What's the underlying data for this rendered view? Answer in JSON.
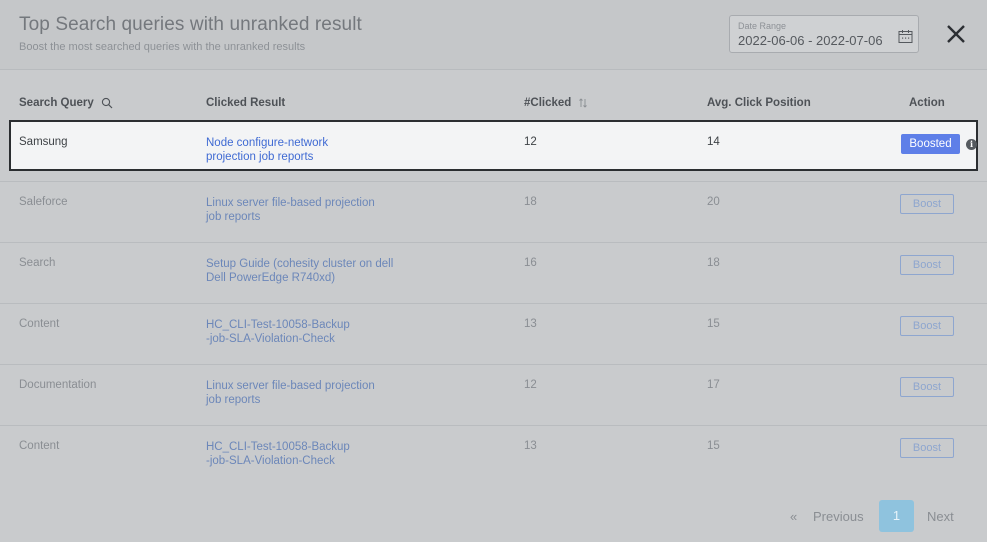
{
  "header": {
    "title": "Top Search queries with unranked result",
    "subtitle": "Boost the most searched queries with the unranked results",
    "date_range_label": "Date Range",
    "date_range_value": "2022-06-06 - 2022-07-06",
    "calendar_icon": "calendar-icon",
    "close_icon": "close-icon"
  },
  "table": {
    "columns": [
      "Search Query",
      "Clicked Result",
      "#Clicked",
      "Avg. Click Position",
      "Action"
    ],
    "rows": [
      {
        "query": "Samsung",
        "result_line1": "Node configure-network",
        "result_line2": "projection job reports",
        "clicked": "12",
        "position": "14",
        "action": "Boosted"
      },
      {
        "query": "Saleforce",
        "result_line1": "Linux server file-based projection",
        "result_line2": "job reports",
        "clicked": "18",
        "position": "20",
        "action": "Boost"
      },
      {
        "query": "Search",
        "result_line1": "Setup Guide (cohesity cluster on dell",
        "result_line2": "Dell PowerEdge R740xd)",
        "clicked": "16",
        "position": "18",
        "action": "Boost"
      },
      {
        "query": "Content",
        "result_line1": "HC_CLI-Test-10058-Backup",
        "result_line2": "-job-SLA-Violation-Check",
        "clicked": "13",
        "position": "15",
        "action": "Boost"
      },
      {
        "query": "Documentation",
        "result_line1": "Linux server file-based projection",
        "result_line2": "job reports",
        "clicked": "12",
        "position": "17",
        "action": "Boost"
      },
      {
        "query": "Content",
        "result_line1": "HC_CLI-Test-10058-Backup",
        "result_line2": "-job-SLA-Violation-Check",
        "clicked": "13",
        "position": "15",
        "action": "Boost"
      }
    ]
  },
  "pagination": {
    "prev_arrow": "«",
    "prev_label": "Previous",
    "current_page": "1",
    "next_label": "Next"
  },
  "colors": {
    "boosted_bg": "#5e7fe8",
    "link": "#3f6ad3",
    "page_current": "#8fc3de"
  }
}
